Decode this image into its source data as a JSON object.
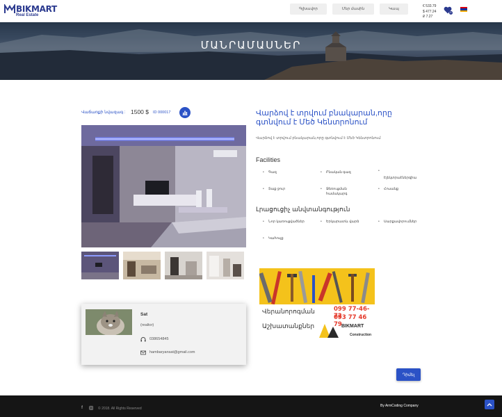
{
  "header": {
    "logo_name": "BIKMART",
    "logo_sub": "Real Estate",
    "nav": [
      "Գլխավոր",
      "Մեր մասին",
      "Կապ"
    ],
    "rates": [
      "€ 533.79",
      "$ 477.24",
      "₽ 7.27"
    ],
    "favorites_count": "0",
    "accent_color": "#2b3a8f"
  },
  "banner": {
    "title": "ՄԱՆՐԱՄԱՍՆԵՐ"
  },
  "listing": {
    "price_label": "Վաճառքի նվազագ :",
    "price_value": "1500 $",
    "id_label": "ID 000017",
    "title": "Վարձով է տրվում բնակարան,որը գտնվում է Մեծ Կենտրոնում",
    "description": "Վարձով է տրվում բնակարան,որը գտնվում է Մեծ Կենտրոնում"
  },
  "facilities": {
    "heading": "Facilities",
    "items": [
      "Գազ",
      "Բնական գազ",
      "Էլեկտրաէներգիա",
      "Տաք ջուր",
      "Ջեռուցման համակարգ",
      "Հոսանք"
    ]
  },
  "comfort": {
    "heading": "Լրացուցիչ անվտանգություն",
    "items": [
      "Նոր կառուցվածներ",
      "Երկարատև վարձ",
      "Սարքավորումներ",
      "Կահույք"
    ]
  },
  "ad": {
    "phone1": "099 77-46-72",
    "phone2": "093 77 46 79",
    "line1": "Վերանորոգման",
    "line2": "Աշխատանքներ",
    "brand": "BIKMART",
    "brand_sub": "Construction"
  },
  "agent": {
    "name": "Sat",
    "role": "(realtor)",
    "phone": "038654845",
    "email": "hambaryansat@gmail.com"
  },
  "actions": {
    "send_label": "Դիմել"
  },
  "footer": {
    "copyright": "© 2018. All Rights Reserved",
    "by": "By ArmCoding Company"
  }
}
